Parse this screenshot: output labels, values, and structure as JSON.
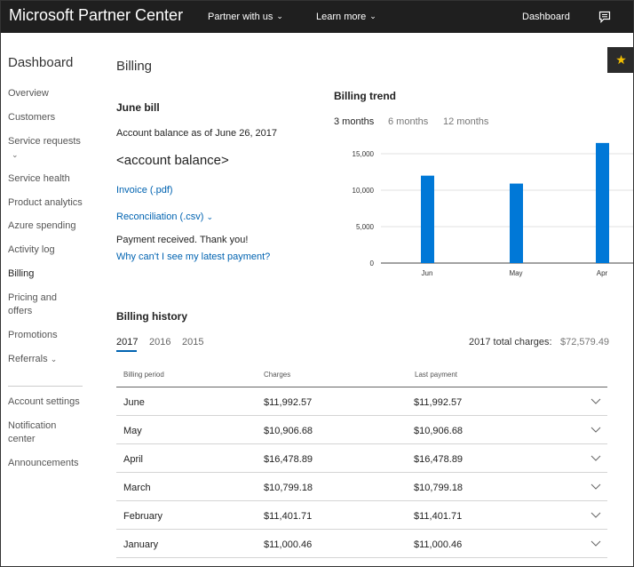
{
  "header": {
    "brand": "Microsoft Partner Center",
    "nav": [
      {
        "label": "Partner with us"
      },
      {
        "label": "Learn more"
      }
    ],
    "dashboard": "Dashboard",
    "star_glyph": "★"
  },
  "sidebar": {
    "title": "Dashboard",
    "items": [
      {
        "label": "Overview"
      },
      {
        "label": "Customers"
      },
      {
        "label": "Service requests"
      },
      {
        "label": "Service health"
      },
      {
        "label": "Product analytics"
      },
      {
        "label": "Azure spending"
      },
      {
        "label": "Activity log"
      },
      {
        "label": "Billing"
      },
      {
        "label": "Pricing and"
      },
      {
        "label": "offers"
      },
      {
        "label": "Promotions"
      },
      {
        "label": "Referrals"
      }
    ],
    "bottom_items": [
      {
        "label": "Account settings"
      },
      {
        "label": "Notification"
      },
      {
        "label": "center"
      },
      {
        "label": "Announcements"
      }
    ]
  },
  "main": {
    "page_title": "Billing",
    "bill": {
      "title": "June bill",
      "balance_as_of": "Account balance as of June 26, 2017",
      "account_balance": "<account balance>",
      "invoice_link": "Invoice (.pdf)",
      "reconciliation_link": "Reconciliation (.csv)",
      "payment_received": "Payment received. Thank you!",
      "why_link": "Why can't I see my latest payment?"
    },
    "trend": {
      "title": "Billing trend",
      "tabs": [
        {
          "label": "3 months"
        },
        {
          "label": "6 months"
        },
        {
          "label": "12 months"
        }
      ]
    },
    "history": {
      "title": "Billing history",
      "years": [
        {
          "label": "2017"
        },
        {
          "label": "2016"
        },
        {
          "label": "2015"
        }
      ],
      "total_label": "2017 total charges:",
      "total_value": "$72,579.49",
      "columns": [
        "Billing period",
        "Charges",
        "Last payment"
      ],
      "rows": [
        {
          "period": "June",
          "charges": "$11,992.57",
          "last_payment": "$11,992.57"
        },
        {
          "period": "May",
          "charges": "$10,906.68",
          "last_payment": "$10,906.68"
        },
        {
          "period": "April",
          "charges": "$16,478.89",
          "last_payment": "$16,478.89"
        },
        {
          "period": "March",
          "charges": "$10,799.18",
          "last_payment": "$10,799.18"
        },
        {
          "period": "February",
          "charges": "$11,401.71",
          "last_payment": "$11,401.71"
        },
        {
          "period": "January",
          "charges": "$11,000.46",
          "last_payment": "$11,000.46"
        }
      ]
    }
  },
  "colors": {
    "topbar": "#1f1f1f",
    "accent": "#0078d7",
    "link": "#0063b1",
    "star": "#f4c000"
  },
  "chart_data": {
    "type": "bar",
    "categories": [
      "Jun",
      "May",
      "Apr"
    ],
    "values": [
      11992.57,
      10906.68,
      16478.89
    ],
    "ylim": [
      0,
      15000
    ],
    "yticks": [
      0,
      5000,
      10000,
      15000
    ],
    "ytick_labels": [
      "0",
      "5,000",
      "10,000",
      "15,000"
    ],
    "grid": true
  }
}
